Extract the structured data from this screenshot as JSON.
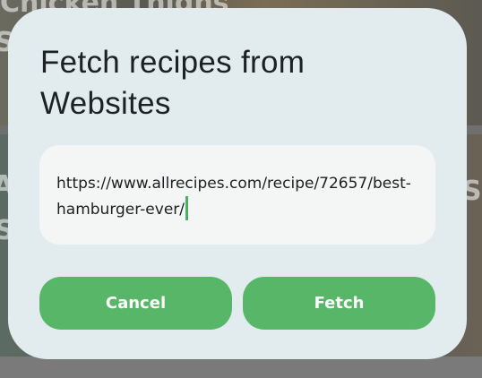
{
  "background": {
    "top_card_title": "Chicken Thighs",
    "left_letter_top": "S",
    "left_letter_mid": "A",
    "left_letter_mid2": "S",
    "right_letter_mid": "S"
  },
  "dialog": {
    "title": "Fetch recipes from Websites",
    "url_input": {
      "value": "https://www.allrecipes.com/recipe/72657/best-hamburger-ever/"
    },
    "cancel_label": "Cancel",
    "fetch_label": "Fetch"
  },
  "colors": {
    "accent": "#58b668",
    "dialog_bg": "#e2ecef",
    "field_bg": "#f4f5f5",
    "caret": "#4caf5f"
  }
}
